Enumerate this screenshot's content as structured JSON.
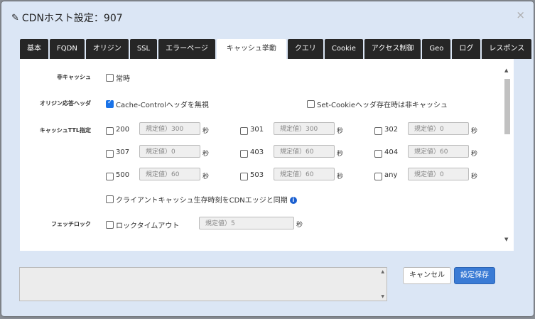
{
  "dialog": {
    "title": "CDNホスト設定：907",
    "close": "×"
  },
  "tabs": [
    "基本",
    "FQDN",
    "オリジン",
    "SSL",
    "エラーページ",
    "キャッシュ挙動",
    "クエリ",
    "Cookie",
    "アクセス制御",
    "Geo",
    "ログ",
    "レスポンス"
  ],
  "active_tab": "キャッシュ挙動",
  "form": {
    "non_cache_label": "非キャッシュ",
    "non_cache_option": "常時",
    "origin_header_label": "オリジン応答ヘッダ",
    "ignore_cache_control": "Cache-Controlヘッダを無視",
    "set_cookie_non_cache": "Set-Cookieヘッダ存在時は非キャッシュ",
    "ttl_label": "キャッシュTTL指定",
    "ttl_rows": [
      [
        {
          "code": "200",
          "value": "規定値）300"
        },
        {
          "code": "301",
          "value": "規定値）300"
        },
        {
          "code": "302",
          "value": "規定値）0"
        }
      ],
      [
        {
          "code": "307",
          "value": "規定値）0"
        },
        {
          "code": "403",
          "value": "規定値）60"
        },
        {
          "code": "404",
          "value": "規定値）60"
        }
      ],
      [
        {
          "code": "500",
          "value": "規定値）60"
        },
        {
          "code": "503",
          "value": "規定値）60"
        },
        {
          "code": "any",
          "value": "規定値）0"
        }
      ]
    ],
    "seconds": "秒",
    "sync_client_cache": "クライアントキャッシュ生存時刻をCDNエッジと同期",
    "info": "i",
    "fetch_lock_label": "フェッチロック",
    "lock_timeout": "ロックタイムアウト",
    "lock_timeout_value": "規定値）5"
  },
  "buttons": {
    "cancel": "キャンセル",
    "save": "設定保存"
  },
  "colors": {
    "accent": "#3a7bd5",
    "tab_dark": "#262626",
    "modal_bg": "#dbe6f5"
  }
}
